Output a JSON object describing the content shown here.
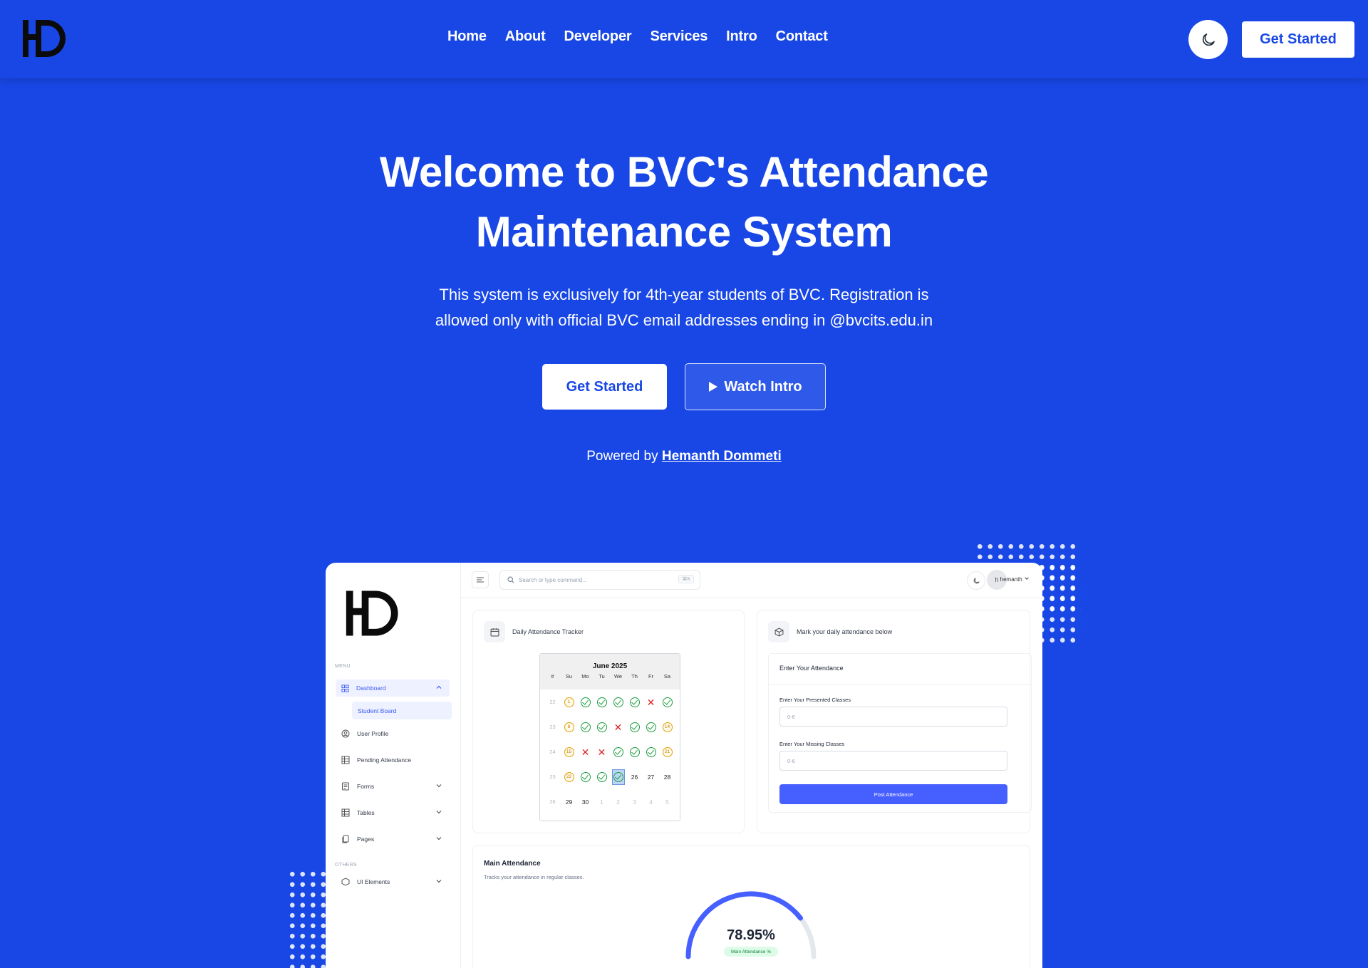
{
  "nav": {
    "links": [
      "Home",
      "About",
      "Developer",
      "Services",
      "Intro",
      "Contact"
    ],
    "cta": "Get Started"
  },
  "hero": {
    "title_line1": "Welcome to BVC's Attendance",
    "title_line2": "Maintenance System",
    "desc_line1": "This system is exclusively for 4th-year students of BVC. Registration is",
    "desc_line2": "allowed only with official BVC email addresses ending in @bvcits.edu.in",
    "primary_button": "Get Started",
    "secondary_button": "Watch Intro",
    "powered_prefix": "Powered by",
    "powered_name": "Hemanth Dommeti"
  },
  "colors": {
    "brand_blue": "#1847e6",
    "accent": "#465fff",
    "present": "#1a9e3e",
    "absent": "#e02424",
    "holiday": "#e3a008"
  },
  "preview": {
    "sidebar": {
      "menu_label": "MENU",
      "items": [
        {
          "label": "Dashboard",
          "icon": "grid-icon",
          "expandable": true,
          "active": true
        },
        {
          "label": "User Profile",
          "icon": "user-circle-icon"
        },
        {
          "label": "Pending Attendance",
          "icon": "table-icon"
        },
        {
          "label": "Forms",
          "icon": "form-icon",
          "expandable": true
        },
        {
          "label": "Tables",
          "icon": "table-icon",
          "expandable": true
        },
        {
          "label": "Pages",
          "icon": "pages-icon",
          "expandable": true
        }
      ],
      "sub_item": "Student Board",
      "others_label": "OTHERS",
      "others_items": [
        {
          "label": "UI Elements",
          "icon": "box-icon",
          "expandable": true
        }
      ]
    },
    "topbar": {
      "search_placeholder": "Search or type command...",
      "shortcut": "⌘K",
      "avatar_initial": "h",
      "username": "hemanth"
    },
    "tracker": {
      "title": "Daily Attendance Tracker",
      "month": "June 2025",
      "days": [
        "#",
        "Su",
        "Mo",
        "Tu",
        "We",
        "Th",
        "Fr",
        "Sa"
      ],
      "weeks": [
        {
          "week": "22",
          "cells": [
            {
              "s": "hol",
              "t": "1"
            },
            {
              "s": "ok"
            },
            {
              "s": "ok"
            },
            {
              "s": "ok"
            },
            {
              "s": "ok"
            },
            {
              "s": "x"
            },
            {
              "s": "ok"
            }
          ]
        },
        {
          "week": "23",
          "cells": [
            {
              "s": "hol",
              "t": "8"
            },
            {
              "s": "ok"
            },
            {
              "s": "ok"
            },
            {
              "s": "x"
            },
            {
              "s": "ok"
            },
            {
              "s": "ok"
            },
            {
              "s": "hol",
              "t": "14"
            }
          ]
        },
        {
          "week": "24",
          "cells": [
            {
              "s": "hol",
              "t": "15"
            },
            {
              "s": "x"
            },
            {
              "s": "x"
            },
            {
              "s": "ok"
            },
            {
              "s": "ok"
            },
            {
              "s": "ok"
            },
            {
              "s": "hol",
              "t": "21"
            }
          ]
        },
        {
          "week": "25",
          "cells": [
            {
              "s": "hol",
              "t": "22"
            },
            {
              "s": "ok"
            },
            {
              "s": "ok"
            },
            {
              "s": "ok",
              "sel": true
            },
            {
              "s": "num",
              "t": "26"
            },
            {
              "s": "num",
              "t": "27"
            },
            {
              "s": "num",
              "t": "28"
            }
          ]
        },
        {
          "week": "26",
          "cells": [
            {
              "s": "num",
              "t": "29"
            },
            {
              "s": "num",
              "t": "30"
            },
            {
              "s": "dim",
              "t": "1"
            },
            {
              "s": "dim",
              "t": "2"
            },
            {
              "s": "dim",
              "t": "3"
            },
            {
              "s": "dim",
              "t": "4"
            },
            {
              "s": "dim",
              "t": "5"
            }
          ]
        }
      ]
    },
    "mark": {
      "title": "Mark your daily attendance below",
      "form_title": "Enter Your Attendance",
      "presented_label": "Enter Your Presented Classes",
      "presented_placeholder": "0-6",
      "missing_label": "Enter Your Missing Classes",
      "missing_placeholder": "0-6",
      "submit": "Post Attendance"
    },
    "main_attendance": {
      "title": "Main Attendance",
      "subtitle": "Tracks your attendance in regular classes.",
      "percent_value": 78.95,
      "percent_text": "78.95%",
      "badge": "Main Attendance %"
    }
  }
}
